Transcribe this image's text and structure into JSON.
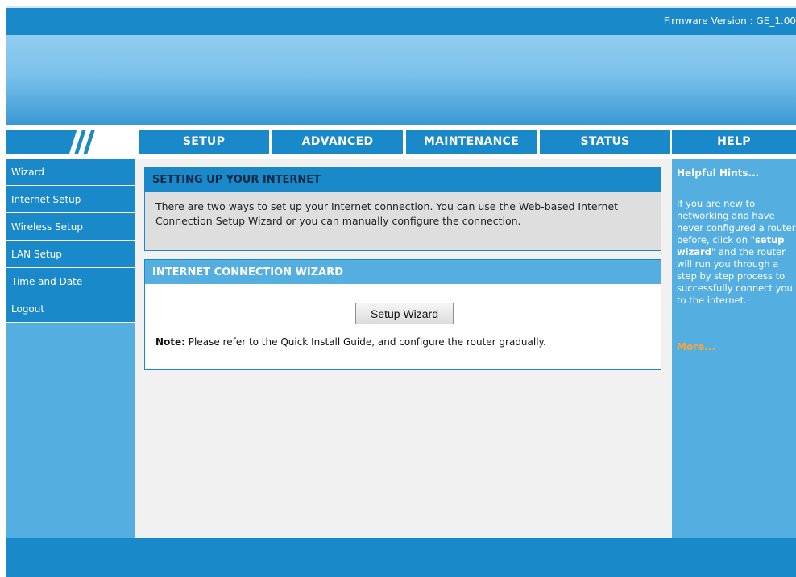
{
  "header": {
    "firmware_label": "Firmware Version : GE_1.00"
  },
  "nav": {
    "tabs": [
      {
        "label": "SETUP"
      },
      {
        "label": "ADVANCED"
      },
      {
        "label": "MAINTENANCE"
      },
      {
        "label": "STATUS"
      },
      {
        "label": "HELP"
      }
    ]
  },
  "sidebar": {
    "items": [
      {
        "label": "Wizard"
      },
      {
        "label": "Internet Setup"
      },
      {
        "label": "Wireless Setup"
      },
      {
        "label": "LAN Setup"
      },
      {
        "label": "Time and Date"
      },
      {
        "label": "Logout"
      }
    ]
  },
  "main": {
    "setup_title": "SETTING UP YOUR INTERNET",
    "setup_text": "There are two ways to set up your Internet connection. You can use the Web-based Internet Connection Setup Wizard or you can manually configure the connection.",
    "wizard_title": "INTERNET CONNECTION WIZARD",
    "wizard_button": "Setup Wizard",
    "note_label": "Note:",
    "note_text": " Please refer to the Quick Install Guide, and configure the router gradually."
  },
  "hints": {
    "title": "Helpful Hints...",
    "text_1": "If you are new to networking and have never configured a router before, click on \"",
    "text_bold": "setup wizard",
    "text_2": "\" and the router will run you through a step by step process to successfully connect you to the internet.",
    "more": "More..."
  },
  "colors": {
    "primary": "#1a89c9",
    "secondary": "#54aedf",
    "accent": "#f2a541"
  }
}
